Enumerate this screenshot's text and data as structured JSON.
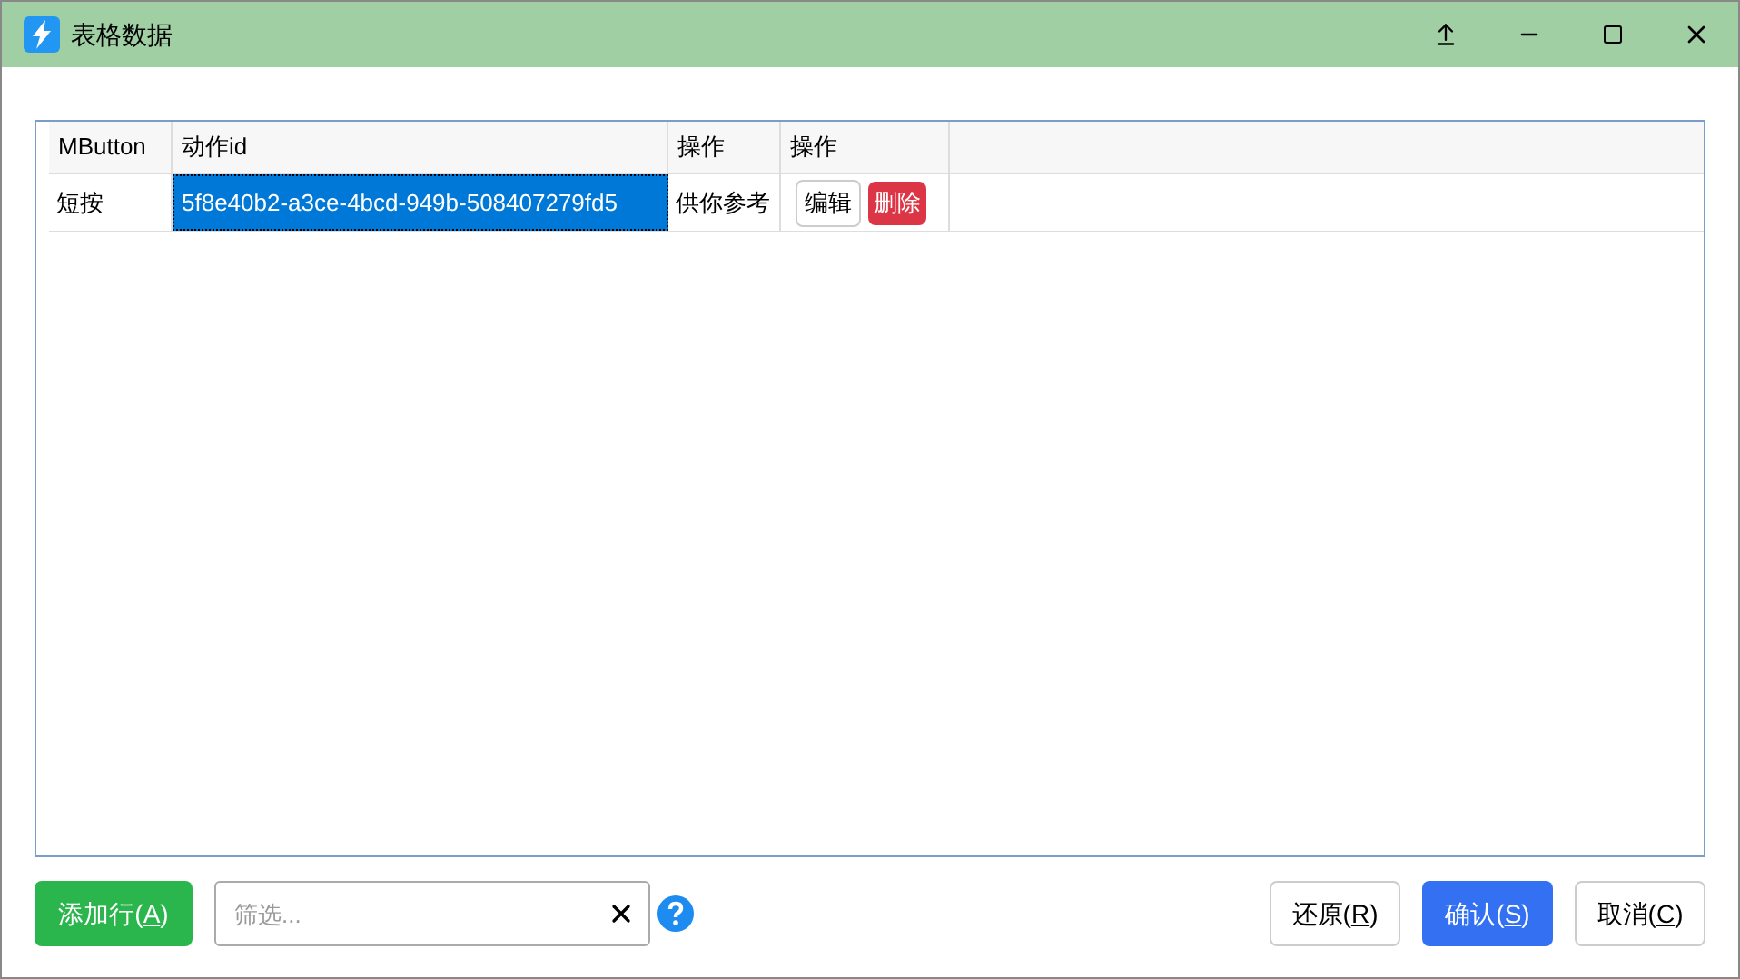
{
  "window": {
    "title": "表格数据"
  },
  "table": {
    "columns": [
      "MButton",
      "动作id",
      "操作",
      "操作"
    ],
    "rows": [
      {
        "cells": [
          {
            "kind": "text",
            "text": "短按",
            "selected": false
          },
          {
            "kind": "text",
            "text": "5f8e40b2-a3ce-4bcd-949b-508407279fd5",
            "selected": true
          },
          {
            "kind": "text",
            "text": "供你参考",
            "selected": false
          },
          {
            "kind": "actions",
            "buttons": [
              {
                "kind": "edit",
                "label": "编辑"
              },
              {
                "kind": "delete",
                "label": "删除"
              }
            ]
          }
        ]
      }
    ]
  },
  "add_button": {
    "text": "添加行(",
    "key": "A",
    "after": ")"
  },
  "filter": {
    "placeholder": "筛选..."
  },
  "buttons": [
    {
      "kind": "plain",
      "text": "还原(",
      "key": "R",
      "after": ")"
    },
    {
      "kind": "primary",
      "text": "确认(",
      "key": "S",
      "after": ")"
    },
    {
      "kind": "plain",
      "text": "取消(",
      "key": "C",
      "after": ")"
    }
  ]
}
